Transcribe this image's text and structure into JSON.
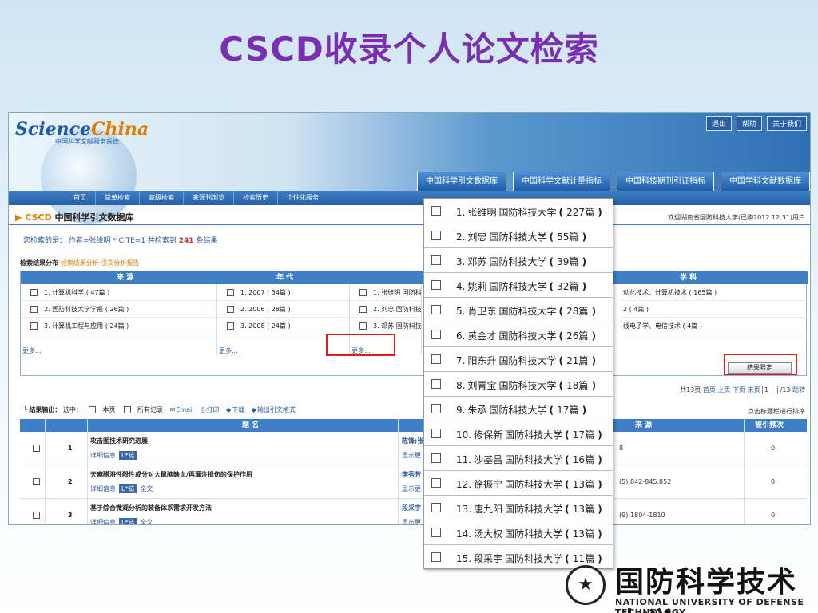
{
  "slide_title": "CSCD收录个人论文检索",
  "site": {
    "logo_main": "Science",
    "logo_accent": "China",
    "logo_sub": "中国科学文献服务系统",
    "top_links": [
      "退出",
      "帮助",
      "关于我们"
    ],
    "db_tabs": [
      "中国科学引文数据库",
      "中国科学文献计量指标",
      "中国科技期刊引证指标",
      "中国学科文献数据库"
    ],
    "nav": [
      "首页",
      "简单检索",
      "高级检索",
      "来源刊浏览",
      "检索历史",
      "个性化服务"
    ],
    "db_title_prefix": "CSCD",
    "db_title": "中国科学引文数据库",
    "welcome": "欢迎湖南省国防科技大学(已购2012.12.31)用户"
  },
  "query": {
    "prefix": "您检索的是：",
    "expr": "作者=张维明 * CITE=1 共检索到",
    "count": "241",
    "suffix": "条结果"
  },
  "analysis": {
    "label": "检索结果分布",
    "links": "检索结果分析 引文分析报告"
  },
  "distribution": {
    "headers": [
      "来 源",
      "年 代",
      "学 科"
    ],
    "source": [
      "1. 计算机科学 ( 47篇 )",
      "2. 国防科技大学学报 ( 26篇 )",
      "3. 计算机工程与应用 ( 24篇 )"
    ],
    "year": [
      "1. 2007 ( 34篇 )",
      "2. 2006 ( 28篇 )",
      "3. 2008 ( 24篇 )"
    ],
    "author": [
      "1. 张维明 国防科",
      "2. 刘忠 国防科技",
      "3. 邓苏 国防科技"
    ],
    "subject": [
      "动化技术、计算机技术 ( 165篇 )",
      "2 ( 4篇 )",
      "线电子学、电信技术 ( 4篇 )"
    ],
    "more": "更多..."
  },
  "limit_button": "结果限定",
  "pager": {
    "text1": "共13页",
    "first": "首页",
    "prev": "上页",
    "next": "下页",
    "last": "末页",
    "page": "1",
    "total": "/13",
    "go": "跳转"
  },
  "export": {
    "label": "结果输出：",
    "selected": "选中：",
    "this_page": "本页",
    "all": "所有记录",
    "email": "Email",
    "print": "打印",
    "download": "下载",
    "cite_format": "输出引文格式"
  },
  "sort_hint": "点击标题栏进行排序",
  "results_headers": {
    "title": "题 名",
    "source": "来 源",
    "cited": "被引频次"
  },
  "results": [
    {
      "num": "1",
      "title": "攻击图技术研究进展",
      "detail": "详细信息",
      "badge": "L*链",
      "fulltext": "",
      "author": "陈锋;张",
      "more": "显示更",
      "src": "8",
      "cited": "0"
    },
    {
      "num": "2",
      "title": "天麻醋浴性酚性成分对大鼠脑缺血/再灌注损伤的保护作用",
      "detail": "详细信息",
      "badge": "L*链",
      "fulltext": "全文",
      "author": "李秀芳",
      "more": "显示更",
      "src": "(5):842-845,852",
      "cited": "0"
    },
    {
      "num": "3",
      "title": "基于综合微观分析的装备体系需求开发方法",
      "detail": "详细信息",
      "badge": "L*链",
      "fulltext": "全文",
      "author": "段采宇",
      "more": "显示更",
      "src": "(9):1804-1810",
      "cited": "0"
    }
  ],
  "author_popup": [
    {
      "rank": "1.",
      "name": "张维明",
      "org": "国防科技大学",
      "count": "227篇"
    },
    {
      "rank": "2.",
      "name": "刘忠",
      "org": "国防科技大学",
      "count": "55篇"
    },
    {
      "rank": "3.",
      "name": "邓苏",
      "org": "国防科技大学",
      "count": "39篇"
    },
    {
      "rank": "4.",
      "name": "姚莉",
      "org": "国防科技大学",
      "count": "32篇"
    },
    {
      "rank": "5.",
      "name": "肖卫东",
      "org": "国防科技大学",
      "count": "28篇"
    },
    {
      "rank": "6.",
      "name": "黄金才",
      "org": "国防科技大学",
      "count": "26篇"
    },
    {
      "rank": "7.",
      "name": "阳东升",
      "org": "国防科技大学",
      "count": "21篇"
    },
    {
      "rank": "8.",
      "name": "刘青宝",
      "org": "国防科技大学",
      "count": "18篇"
    },
    {
      "rank": "9.",
      "name": "朱承",
      "org": "国防科技大学",
      "count": "17篇"
    },
    {
      "rank": "10.",
      "name": "修保新",
      "org": "国防科技大学",
      "count": "17篇"
    },
    {
      "rank": "11.",
      "name": "沙基昌",
      "org": "国防科技大学",
      "count": "16篇"
    },
    {
      "rank": "12.",
      "name": "徐振宁",
      "org": "国防科技大学",
      "count": "13篇"
    },
    {
      "rank": "13.",
      "name": "唐九阳",
      "org": "国防科技大学",
      "count": "13篇"
    },
    {
      "rank": "14.",
      "name": "汤大权",
      "org": "国防科技大学",
      "count": "13篇"
    },
    {
      "rank": "15.",
      "name": "段采宇",
      "org": "国防科技大学",
      "count": "11篇"
    }
  ],
  "footer": {
    "emblem_glyph": "★",
    "uni_cn": "国防科学技术大学",
    "uni_en": "NATIONAL UNIVERSITY OF DEFENSE TECHNOLOGY"
  },
  "colors": {
    "title": "#7a2fb0",
    "highlight": "#e01b1b",
    "nav_blue": "#3f7fc6",
    "accent_orange": "#e07b00"
  }
}
